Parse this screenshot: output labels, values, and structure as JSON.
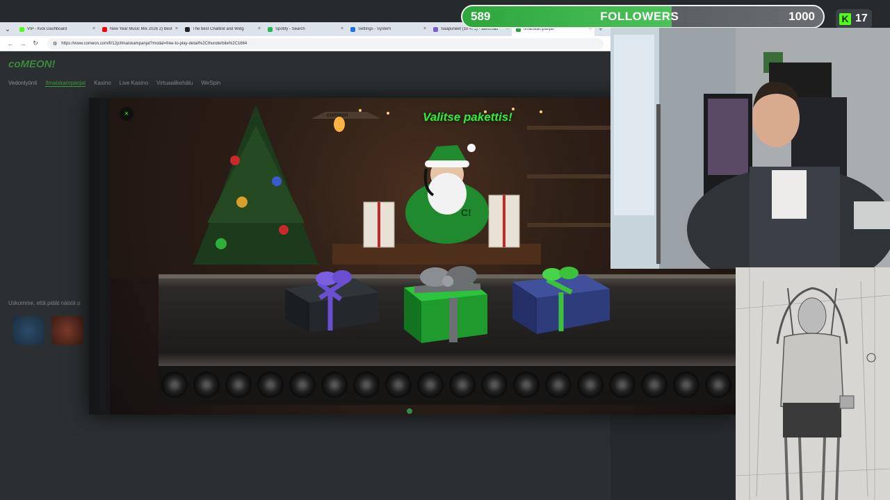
{
  "browser": {
    "tabs": [
      {
        "label": "VIP - Kick Dashboard",
        "color": "#53fc18"
      },
      {
        "label": "New Year Music Mix 2026 2) Best",
        "color": "#ff0000"
      },
      {
        "label": "The best ChatBot and Widg",
        "color": "#222222"
      },
      {
        "label": "Spotify - Search",
        "color": "#1db954"
      },
      {
        "label": "Settings - System",
        "color": "#1a73e8"
      },
      {
        "label": "Saapuneet (10 473) - aleximau",
        "color": "#7b5cd6"
      },
      {
        "label": "Ilmaiskampanjat",
        "color": "#2f9e44"
      }
    ],
    "close_glyph": "×",
    "new_tab_glyph": "+",
    "menu_glyph": "⌄",
    "nav": {
      "back": "←",
      "forward": "→",
      "reload": "↻"
    },
    "url": "https://www.comeon.com/fi/12p/ilmaiskampanjat?modal=free-to-play-detail%2Cthunderbite%2C1664"
  },
  "site": {
    "logo": "coMEON!",
    "nav": [
      "Vedonlyönti",
      "Ilmaiskampanjat",
      "Kasino",
      "Live Kasino",
      "Virtuaalikehälu",
      "WeSpin"
    ],
    "active_nav_index": 1,
    "background_text": "Uskomme, että pidät näistä p"
  },
  "modal": {
    "close_label": "×",
    "title": "Valitse pakettis!",
    "lamp_text": "comeon",
    "gifts": [
      {
        "name": "black",
        "box": "#1e2124",
        "ribbon": "#6a4fd0"
      },
      {
        "name": "green",
        "box": "#1f9b2e",
        "ribbon": "#6b6f72"
      },
      {
        "name": "blue",
        "box": "#2e3c7c",
        "ribbon": "#3cc13c"
      }
    ]
  },
  "overlay": {
    "followers_current": "589",
    "followers_label": "FOLLOWERS",
    "followers_goal": "1000",
    "kick_viewers": "17",
    "kick_letter": "K"
  }
}
